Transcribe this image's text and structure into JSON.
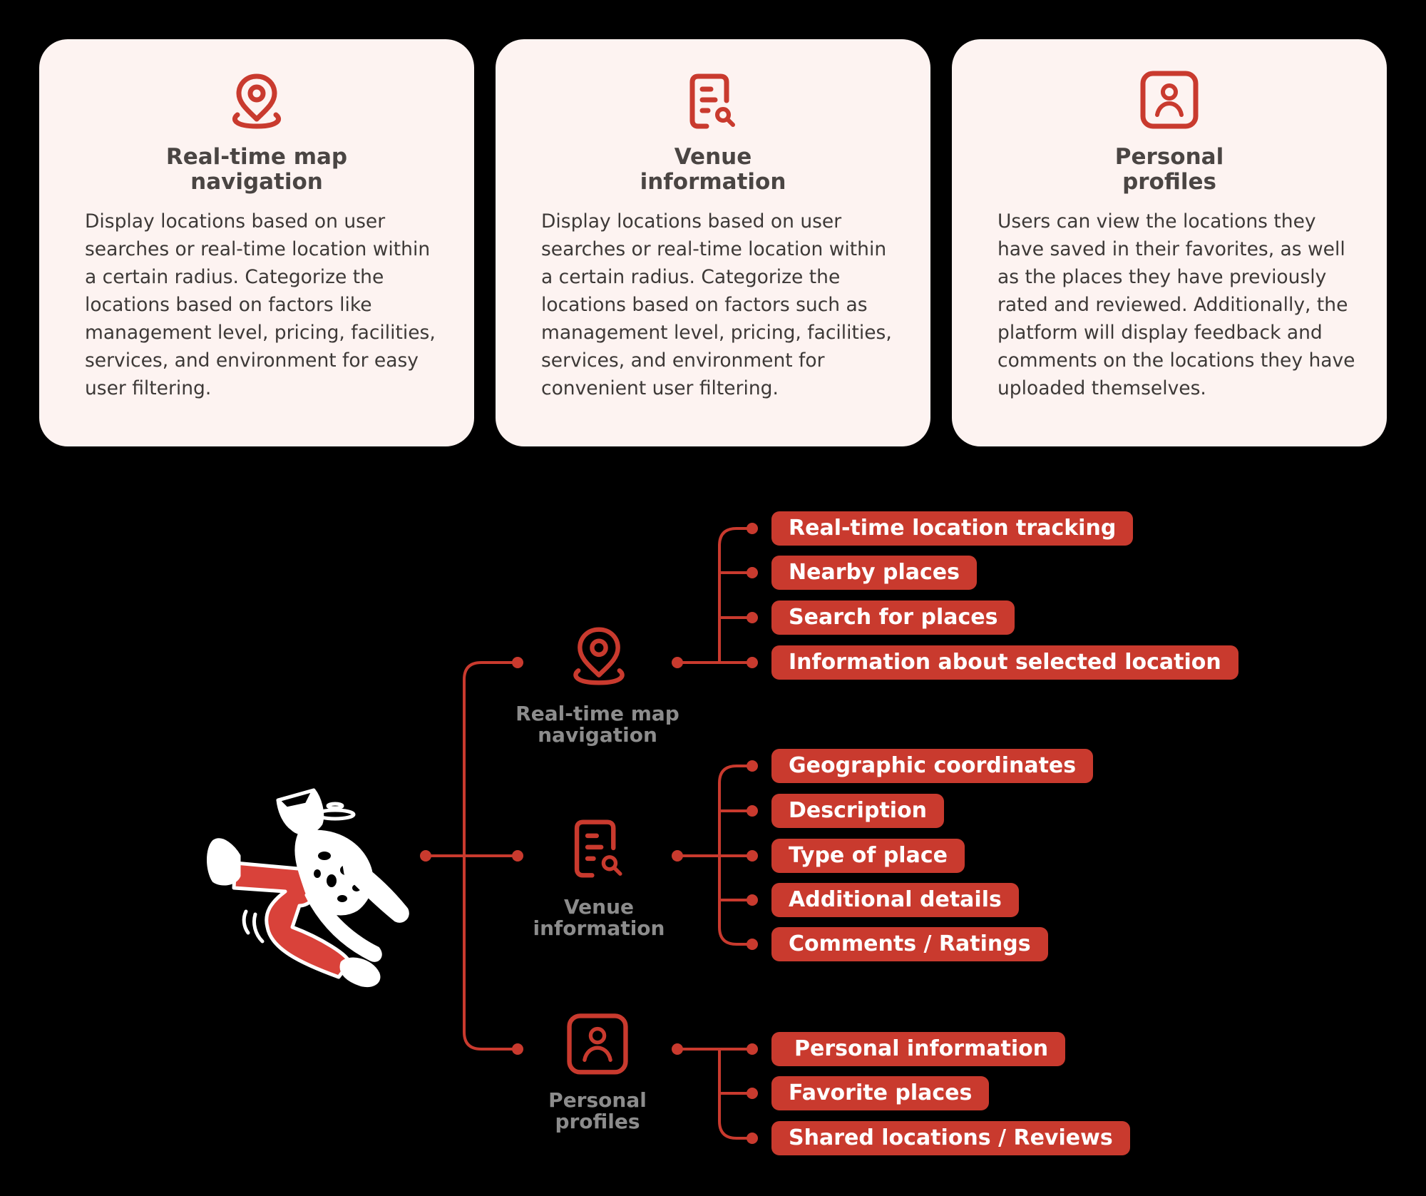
{
  "colors": {
    "background": "#000000",
    "card_bg": "#FDF3F1",
    "accent": "#C93A2E",
    "title_text": "#4A4543",
    "body_text": "#3D3937",
    "category_label": "#8C8C8C",
    "pill_text": "#FFFFFF"
  },
  "cards": [
    {
      "icon": "map-pin-icon",
      "title_line1": "Real-time map",
      "title_line2": "navigation",
      "description": "Display locations based on user searches or real-time location within a certain radius. Categorize the locations based on factors like management level, pricing, facilities, services, and environment for easy user filtering."
    },
    {
      "icon": "document-search-icon",
      "title_line1": "Venue",
      "title_line2": "information",
      "description": "Display locations based on user searches or real-time location within a certain radius. Categorize the locations based on factors such as management level, pricing, facilities, services, and environment for convenient user filtering."
    },
    {
      "icon": "user-profile-icon",
      "title_line1": "Personal",
      "title_line2": "profiles",
      "description": "Users can view the locations they have saved in their favorites, as well as the places they have previously rated and reviewed. Additionally, the platform will display feedback and comments on the locations they have uploaded themselves."
    }
  ],
  "tree": {
    "root": {
      "icon": "running-person-illustration"
    },
    "groups": [
      {
        "icon": "map-pin-icon",
        "label_line1": "Real-time map",
        "label_line2": "navigation",
        "items": [
          "Real-time location tracking",
          "Nearby places",
          "Search for places",
          "Information about selected location"
        ]
      },
      {
        "icon": "document-search-icon",
        "label_line1": "Venue",
        "label_line2": "information",
        "items": [
          "Geographic coordinates",
          "Description",
          "Type of place",
          "Additional details",
          "Comments / Ratings"
        ]
      },
      {
        "icon": "user-profile-icon",
        "label_line1": "Personal",
        "label_line2": "profiles",
        "items": [
          "Personal information",
          "Favorite places",
          "Shared locations / Reviews"
        ]
      }
    ]
  }
}
